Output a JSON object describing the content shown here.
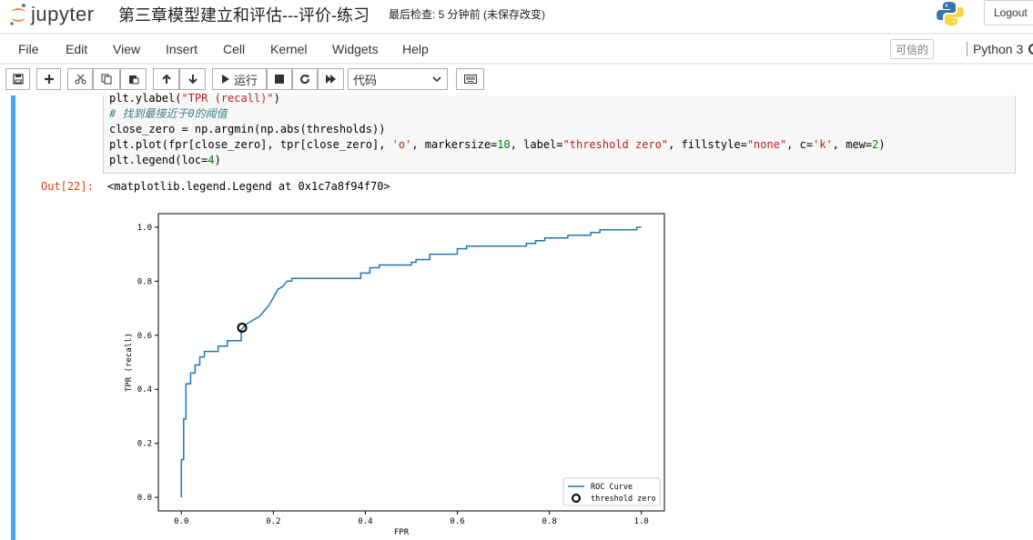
{
  "header": {
    "brand": "jupyter",
    "notebook_title": "第三章模型建立和评估---评价-练习",
    "checkpoint": "最后检查: 5 分钟前  (未保存改变)",
    "logout_label": "Logout"
  },
  "menubar": {
    "items": [
      "File",
      "Edit",
      "View",
      "Insert",
      "Cell",
      "Kernel",
      "Widgets",
      "Help"
    ],
    "trusted": "可信的",
    "kernel": "Python 3"
  },
  "toolbar": {
    "run_label": "运行",
    "cell_type": "代码"
  },
  "cell": {
    "code_lines": [
      "plt.ylabel(\"TPR (recall)\")",
      "# 找到最接近于0的阈值",
      "close_zero = np.argmin(np.abs(thresholds))",
      "plt.plot(fpr[close_zero], tpr[close_zero], 'o', markersize=10, label=\"threshold zero\", fillstyle=\"none\", c='k', mew=2)",
      "plt.legend(loc=4)"
    ],
    "out_prompt": "Out[22]:",
    "out_text": "<matplotlib.legend.Legend at 0x1c7a8f94f70>"
  },
  "chart_data": {
    "type": "line",
    "xlabel": "FPR",
    "ylabel": "TPR (recall)",
    "xlim": [
      -0.05,
      1.05
    ],
    "ylim": [
      -0.05,
      1.05
    ],
    "xticks": [
      "0.0",
      "0.2",
      "0.4",
      "0.6",
      "0.8",
      "1.0"
    ],
    "yticks": [
      "0.0",
      "0.2",
      "0.4",
      "0.6",
      "0.8",
      "1.0"
    ],
    "legend_position": "lower-right",
    "line_color": "#1f77b4",
    "series": [
      {
        "name": "ROC Curve",
        "x": [
          0.0,
          0.0,
          0.0,
          0.005,
          0.005,
          0.01,
          0.01,
          0.02,
          0.02,
          0.03,
          0.03,
          0.04,
          0.04,
          0.05,
          0.05,
          0.08,
          0.08,
          0.1,
          0.1,
          0.13,
          0.13,
          0.14,
          0.15,
          0.16,
          0.17,
          0.18,
          0.19,
          0.2,
          0.21,
          0.22,
          0.23,
          0.24,
          0.24,
          0.3,
          0.3,
          0.39,
          0.39,
          0.41,
          0.41,
          0.43,
          0.43,
          0.5,
          0.5,
          0.51,
          0.51,
          0.54,
          0.54,
          0.6,
          0.6,
          0.62,
          0.62,
          0.75,
          0.75,
          0.77,
          0.77,
          0.79,
          0.79,
          0.84,
          0.84,
          0.89,
          0.89,
          0.91,
          0.91,
          0.96,
          0.96,
          0.99,
          0.99,
          1.0
        ],
        "y": [
          0.0,
          0.14,
          0.14,
          0.14,
          0.29,
          0.29,
          0.42,
          0.42,
          0.46,
          0.46,
          0.49,
          0.49,
          0.52,
          0.52,
          0.54,
          0.54,
          0.56,
          0.56,
          0.58,
          0.58,
          0.62,
          0.64,
          0.65,
          0.66,
          0.67,
          0.69,
          0.71,
          0.74,
          0.77,
          0.78,
          0.8,
          0.8,
          0.81,
          0.81,
          0.81,
          0.81,
          0.83,
          0.83,
          0.85,
          0.85,
          0.86,
          0.86,
          0.87,
          0.87,
          0.88,
          0.88,
          0.9,
          0.9,
          0.92,
          0.92,
          0.93,
          0.93,
          0.94,
          0.94,
          0.95,
          0.95,
          0.96,
          0.96,
          0.97,
          0.97,
          0.98,
          0.98,
          0.99,
          0.99,
          0.99,
          0.99,
          1.0,
          1.0
        ]
      },
      {
        "name": "threshold zero",
        "x": [
          0.132
        ],
        "y": [
          0.628
        ]
      }
    ]
  }
}
